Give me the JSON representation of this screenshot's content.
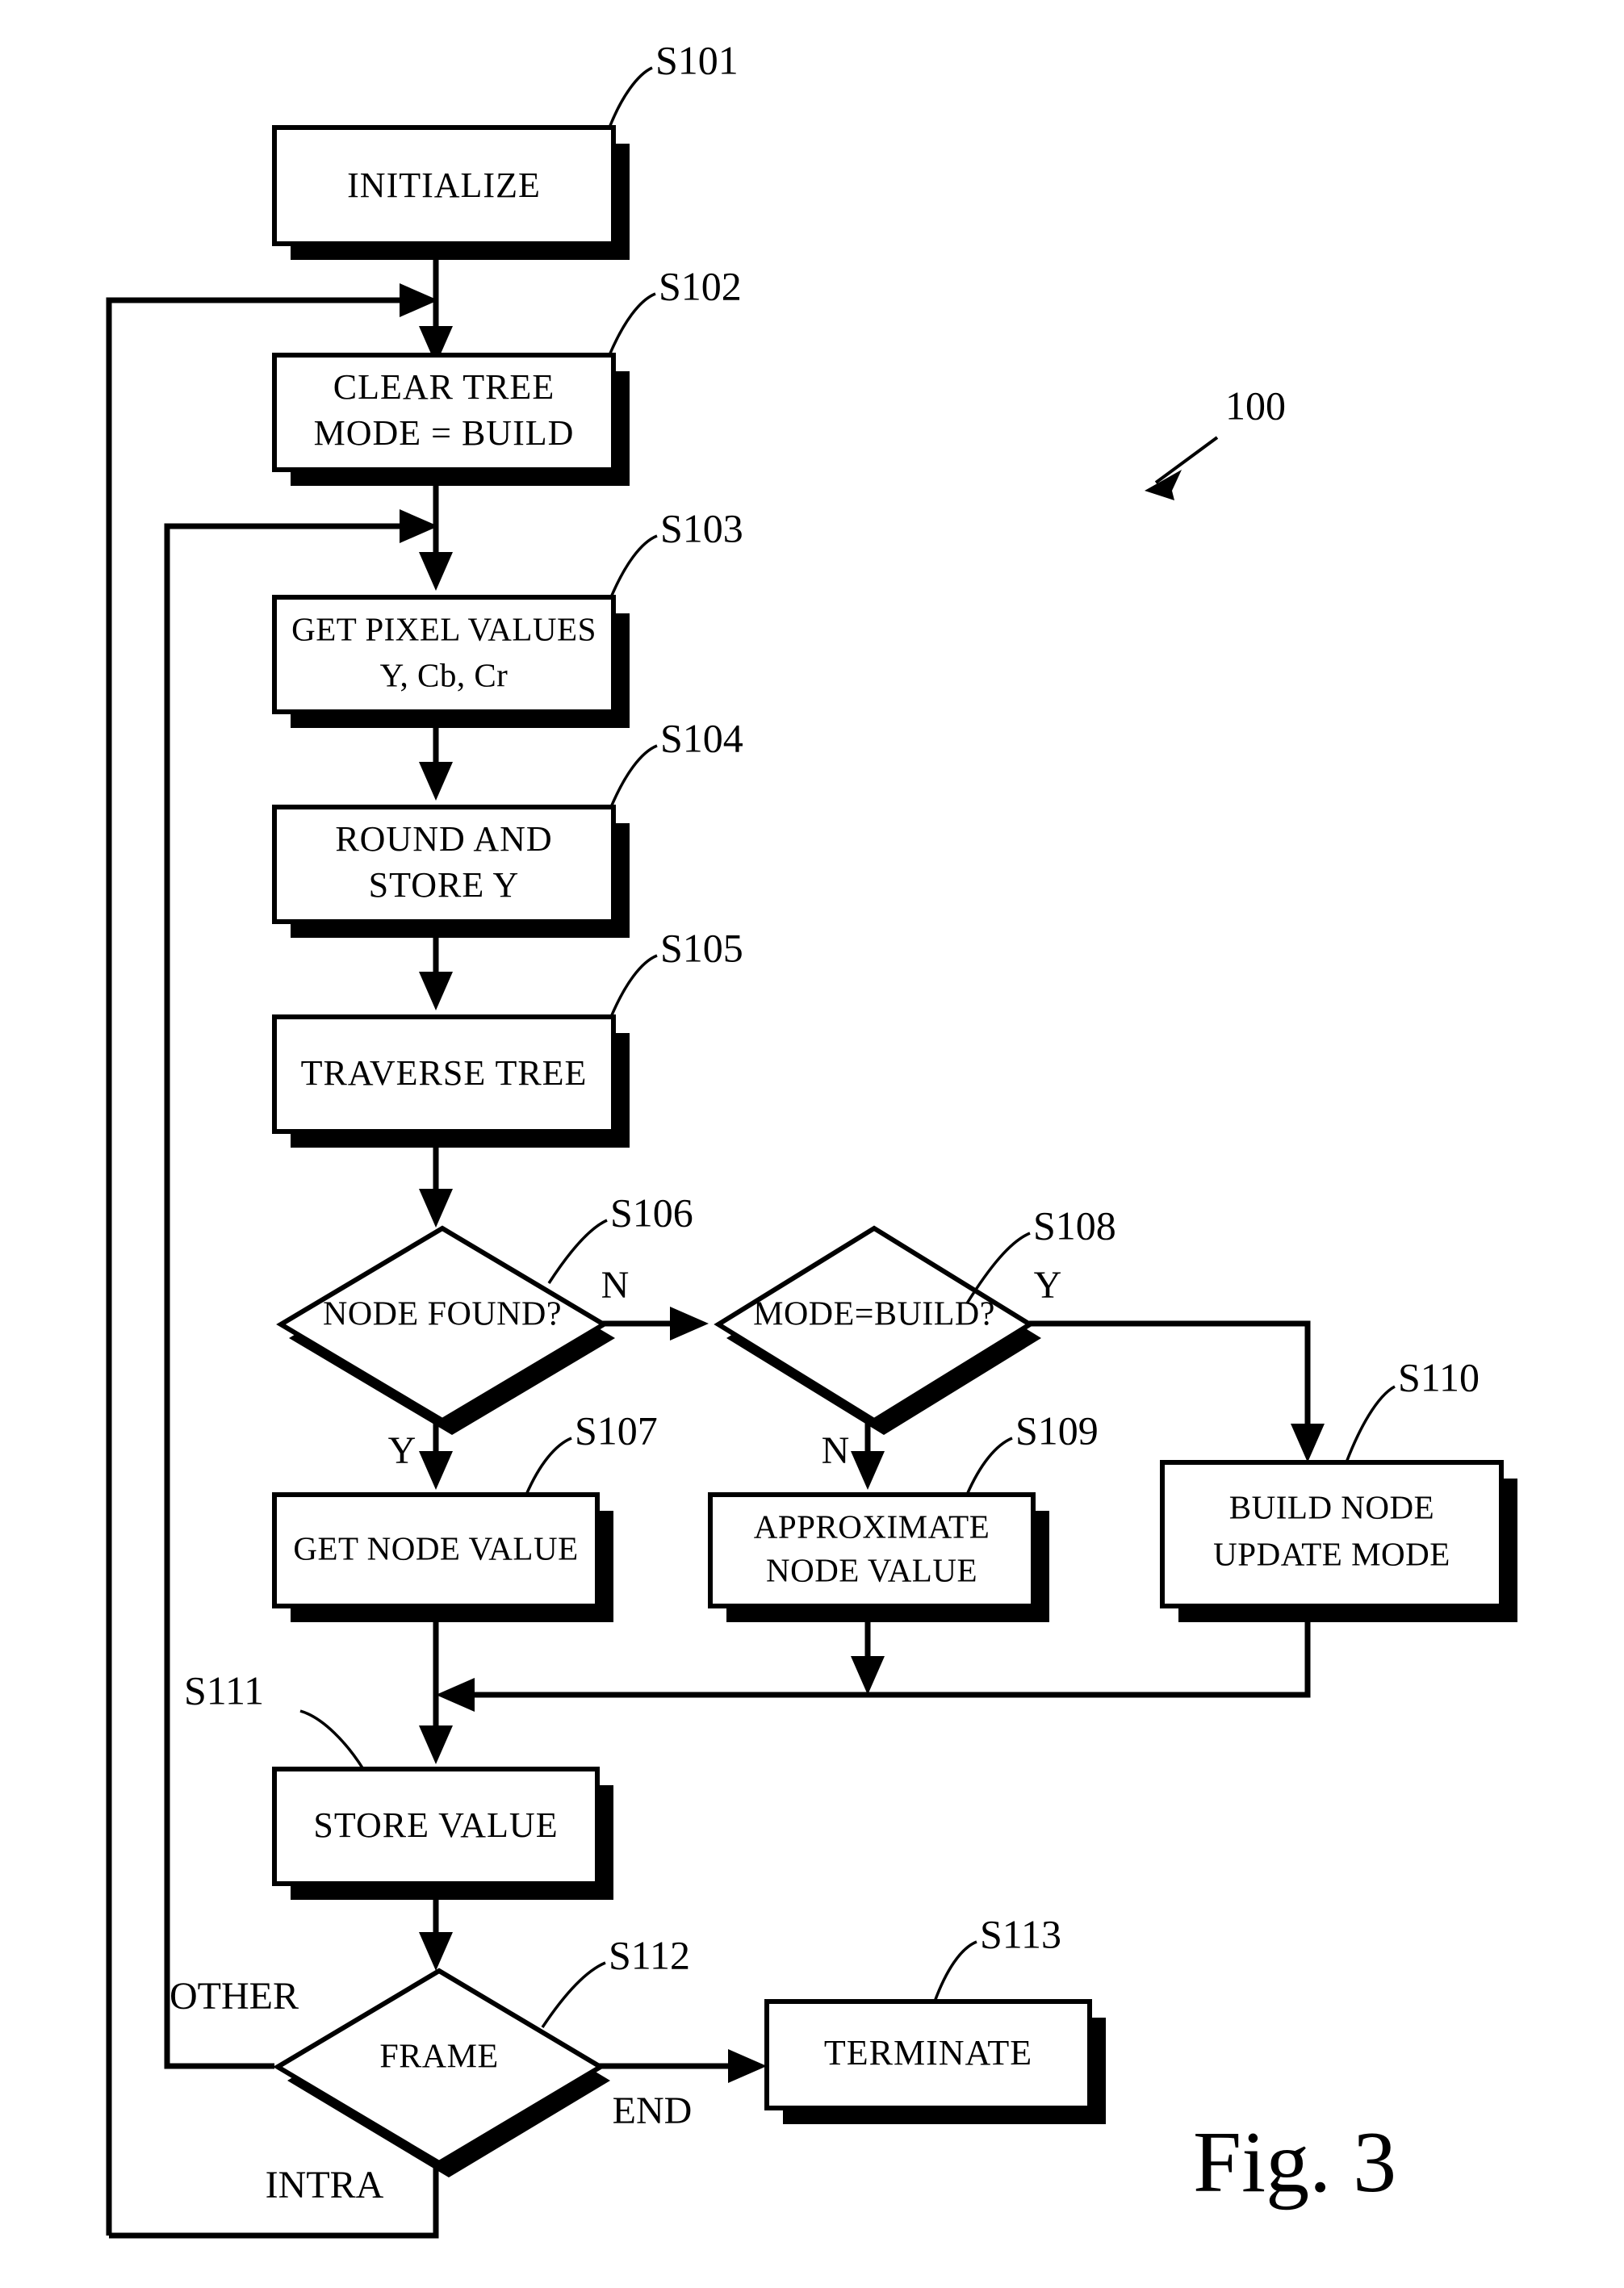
{
  "figure": {
    "caption": "Fig. 3",
    "system_ref": "100"
  },
  "nodes": [
    {
      "id": "S101",
      "ref": "S101",
      "type": "process",
      "lines": [
        "INITIALIZE"
      ]
    },
    {
      "id": "S102",
      "ref": "S102",
      "type": "process",
      "lines": [
        "CLEAR TREE",
        "MODE = BUILD"
      ]
    },
    {
      "id": "S103",
      "ref": "S103",
      "type": "process",
      "lines": [
        "GET PIXEL VALUES",
        "Y, Cb, Cr"
      ]
    },
    {
      "id": "S104",
      "ref": "S104",
      "type": "process",
      "lines": [
        "ROUND AND",
        "STORE  Y"
      ]
    },
    {
      "id": "S105",
      "ref": "S105",
      "type": "process",
      "lines": [
        "TRAVERSE TREE"
      ]
    },
    {
      "id": "S106",
      "ref": "S106",
      "type": "decision",
      "lines": [
        "NODE FOUND?"
      ]
    },
    {
      "id": "S107",
      "ref": "S107",
      "type": "process",
      "lines": [
        "GET NODE VALUE"
      ]
    },
    {
      "id": "S108",
      "ref": "S108",
      "type": "decision",
      "lines": [
        "MODE=BUILD?"
      ]
    },
    {
      "id": "S109",
      "ref": "S109",
      "type": "process",
      "lines": [
        "APPROXIMATE",
        "NODE VALUE"
      ]
    },
    {
      "id": "S110",
      "ref": "S110",
      "type": "process",
      "lines": [
        "BUILD NODE",
        "UPDATE MODE"
      ]
    },
    {
      "id": "S111",
      "ref": "S111",
      "type": "process",
      "lines": [
        "STORE VALUE"
      ]
    },
    {
      "id": "S112",
      "ref": "S112",
      "type": "decision",
      "lines": [
        "FRAME"
      ]
    },
    {
      "id": "S113",
      "ref": "S113",
      "type": "process",
      "lines": [
        "TERMINATE"
      ]
    }
  ],
  "branch_labels": {
    "s106_no": "N",
    "s106_yes": "Y",
    "s108_yes": "Y",
    "s108_no": "N",
    "s112_other": "OTHER",
    "s112_intra": "INTRA",
    "s112_end": "END"
  },
  "edges": [
    {
      "from": "S101",
      "to": "S102",
      "label": ""
    },
    {
      "from": "S102",
      "to": "S103",
      "label": ""
    },
    {
      "from": "S103",
      "to": "S104",
      "label": ""
    },
    {
      "from": "S104",
      "to": "S105",
      "label": ""
    },
    {
      "from": "S105",
      "to": "S106",
      "label": ""
    },
    {
      "from": "S106",
      "to": "S107",
      "label": "Y"
    },
    {
      "from": "S106",
      "to": "S108",
      "label": "N"
    },
    {
      "from": "S108",
      "to": "S109",
      "label": "N"
    },
    {
      "from": "S108",
      "to": "S110",
      "label": "Y"
    },
    {
      "from": "S107",
      "to": "S111",
      "label": ""
    },
    {
      "from": "S109",
      "to": "S111",
      "label": ""
    },
    {
      "from": "S110",
      "to": "S111",
      "label": ""
    },
    {
      "from": "S111",
      "to": "S112",
      "label": ""
    },
    {
      "from": "S112",
      "to": "S113",
      "label": "END"
    },
    {
      "from": "S112",
      "to": "S103",
      "label": "OTHER"
    },
    {
      "from": "S112",
      "to": "S102",
      "label": "INTRA"
    }
  ]
}
